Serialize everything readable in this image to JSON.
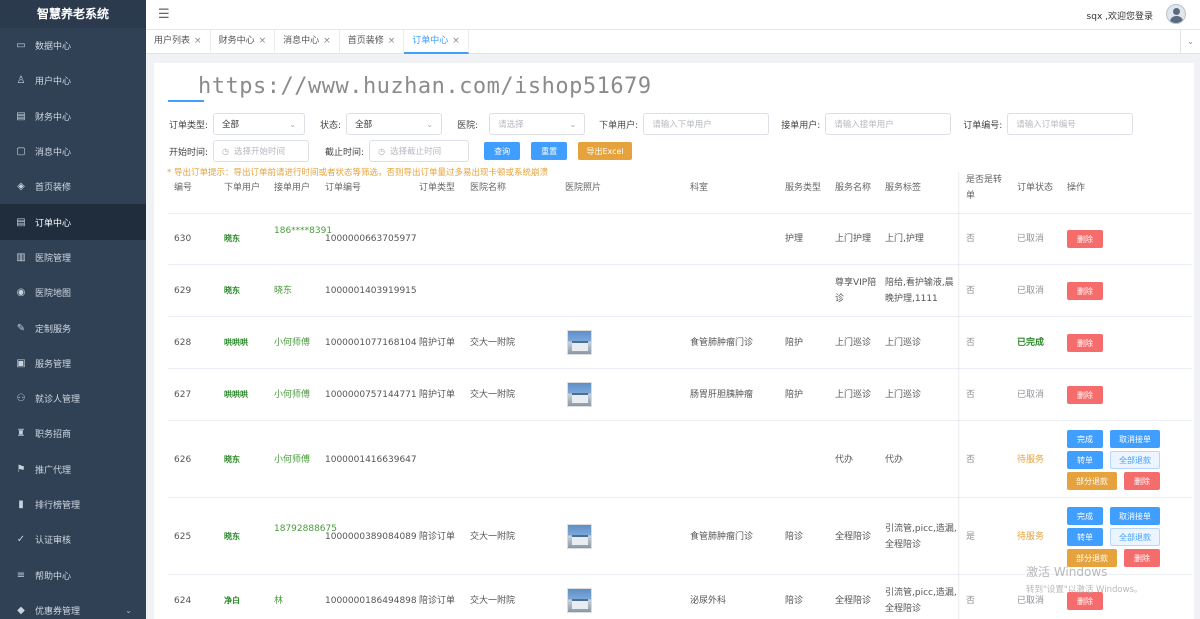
{
  "brand": "智慧养老系统",
  "sidebar": [
    {
      "label": "数据中心",
      "icon": "monitor-icon"
    },
    {
      "label": "用户中心",
      "icon": "user-icon"
    },
    {
      "label": "财务中心",
      "icon": "wallet-icon"
    },
    {
      "label": "消息中心",
      "icon": "message-icon"
    },
    {
      "label": "首页装修",
      "icon": "cube-icon"
    },
    {
      "label": "订单中心",
      "icon": "document-icon"
    },
    {
      "label": "医院管理",
      "icon": "hospital-icon"
    },
    {
      "label": "医院地图",
      "icon": "location-icon"
    },
    {
      "label": "定制服务",
      "icon": "edit-icon"
    },
    {
      "label": "服务管理",
      "icon": "clipboard-icon"
    },
    {
      "label": "就诊人管理",
      "icon": "patient-icon"
    },
    {
      "label": "职务招商",
      "icon": "briefcase-icon"
    },
    {
      "label": "推广代理",
      "icon": "share-icon"
    },
    {
      "label": "排行榜管理",
      "icon": "bar-chart-icon"
    },
    {
      "label": "认证审核",
      "icon": "verify-icon"
    },
    {
      "label": "帮助中心",
      "icon": "list-icon"
    },
    {
      "label": "优惠券管理",
      "icon": "coupon-icon"
    }
  ],
  "header": {
    "greeting": "sqx ,欢迎您登录"
  },
  "tabs": [
    "用户列表",
    "财务中心",
    "消息中心",
    "首页装修",
    "订单中心"
  ],
  "watermark": "https://www.huzhan.com/ishop51679",
  "filters": {
    "order_type_label": "订单类型:",
    "order_type_value": "全部",
    "status_label": "状态:",
    "status_value": "全部",
    "hospital_label": "医院:",
    "hospital_placeholder": "请选择",
    "order_user_label": "下单用户:",
    "order_user_placeholder": "请输入下单用户",
    "taker_label": "接单用户:",
    "taker_placeholder": "请输入接单用户",
    "order_no_label": "订单编号:",
    "order_no_placeholder": "请输入订单编号",
    "start_label": "开始时间:",
    "start_placeholder": "选择开始时间",
    "end_label": "截止时间:",
    "end_placeholder": "选择截止时间",
    "query": "查询",
    "reset": "重置",
    "export": "导出Excel"
  },
  "note": "* 导出订单提示：导出订单前请进行时间或者状态等筛选，否则导出订单量过多易出现卡顿或系统崩溃",
  "columns": [
    "编号",
    "下单用户",
    "接单用户",
    "订单编号",
    "订单类型",
    "医院名称",
    "医院照片",
    "科室",
    "服务类型",
    "服务名称",
    "服务标签",
    "是否是转单",
    "订单状态",
    "操作"
  ],
  "rows": [
    {
      "id": "630",
      "user": "晓东",
      "taker": "186****8391",
      "order_no": "1000000663705977",
      "type": "",
      "hospital": "",
      "photo": false,
      "dept": "",
      "service_type": "护理",
      "service_name": "上门护理",
      "tags": "上门,护理",
      "transfer": "否",
      "status": "已取消"
    },
    {
      "id": "629",
      "user": "晓东",
      "taker": "晓东",
      "order_no": "1000001403919915",
      "type": "",
      "hospital": "",
      "photo": false,
      "dept": "",
      "service_type": "",
      "service_name": "尊享VIP陪诊",
      "tags": "陪给,看护输液,晨晚护理,1111",
      "transfer": "否",
      "status": "已取消"
    },
    {
      "id": "628",
      "user": "哄哄哄",
      "taker": "小何师傅",
      "order_no": "1000001077168104",
      "type": "陪护订单",
      "hospital": "交大一附院",
      "photo": true,
      "dept": "食管肺肿瘤门诊",
      "service_type": "陪护",
      "service_name": "上门巡诊",
      "tags": "上门巡诊",
      "transfer": "否",
      "status": "已完成"
    },
    {
      "id": "627",
      "user": "哄哄哄",
      "taker": "小何师傅",
      "order_no": "1000000757144771",
      "type": "陪护订单",
      "hospital": "交大一附院",
      "photo": true,
      "dept": "肠胃肝胆胰肿瘤",
      "service_type": "陪护",
      "service_name": "上门巡诊",
      "tags": "上门巡诊",
      "transfer": "否",
      "status": "已取消"
    },
    {
      "id": "626",
      "user": "晓东",
      "taker": "小何师傅",
      "order_no": "1000001416639647",
      "type": "",
      "hospital": "",
      "photo": false,
      "dept": "",
      "service_type": "",
      "service_name": "代办",
      "tags": "代办",
      "transfer": "否",
      "status": "待服务"
    },
    {
      "id": "625",
      "user": "晓东",
      "taker": "18792888675",
      "order_no": "1000000389084089",
      "type": "陪诊订单",
      "hospital": "交大一附院",
      "photo": true,
      "dept": "食管肺肿瘤门诊",
      "service_type": "陪诊",
      "service_name": "全程陪诊",
      "tags": "引流管,picc,造漏,全程陪诊",
      "transfer": "是",
      "status": "待服务"
    },
    {
      "id": "624",
      "user": "净白",
      "taker": "林",
      "order_no": "1000000186494898",
      "type": "陪诊订单",
      "hospital": "交大一附院",
      "photo": true,
      "dept": "泌尿外科",
      "service_type": "陪诊",
      "service_name": "全程陪诊",
      "tags": "引流管,picc,造漏,全程陪诊",
      "transfer": "否",
      "status": "已取消"
    }
  ],
  "actions": {
    "complete": "完成",
    "cancel_take": "取消接单",
    "transfer": "转单",
    "full_refund": "全部退款",
    "partial_refund": "部分退款",
    "delete": "删除"
  },
  "windows": {
    "line1": "激活 Windows",
    "line2": "转到\"设置\"以激活 Windows。"
  },
  "colors": {
    "sidebar": "#304156",
    "primary": "#409eff",
    "warning": "#e6a23c",
    "danger": "#f56c6c",
    "success": "#2b8a2b"
  }
}
